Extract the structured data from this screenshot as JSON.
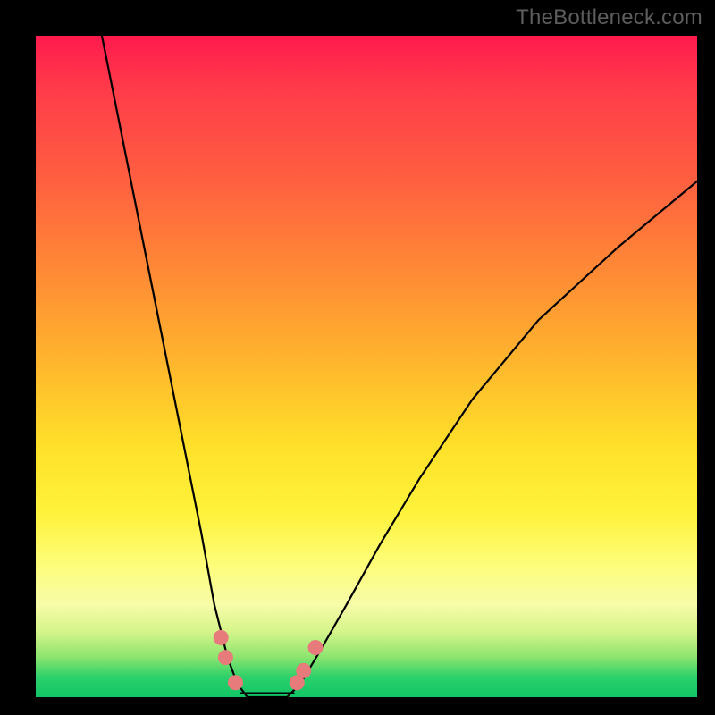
{
  "watermark": "TheBottleneck.com",
  "chart_data": {
    "type": "line",
    "title": "",
    "xlabel": "",
    "ylabel": "",
    "xlim": [
      0,
      100
    ],
    "ylim": [
      0,
      100
    ],
    "grid": false,
    "legend": false,
    "series": [
      {
        "name": "left-branch",
        "x": [
          10,
          13,
          16,
          19,
          22,
          25,
          27,
          29,
          30.5,
          32
        ],
        "y": [
          100,
          85,
          70,
          55,
          40,
          25,
          14,
          6,
          2,
          0
        ]
      },
      {
        "name": "right-branch",
        "x": [
          38,
          40,
          43,
          47,
          52,
          58,
          66,
          76,
          88,
          100
        ],
        "y": [
          0,
          2,
          7,
          14,
          23,
          33,
          45,
          57,
          68,
          78
        ]
      },
      {
        "name": "trough-flat",
        "x": [
          32,
          34,
          36,
          38
        ],
        "y": [
          0,
          0,
          0,
          0
        ]
      }
    ],
    "markers": [
      {
        "x": 28,
        "y": 9
      },
      {
        "x": 28.7,
        "y": 6
      },
      {
        "x": 30.2,
        "y": 2.2
      },
      {
        "x": 39.5,
        "y": 2.2
      },
      {
        "x": 40.5,
        "y": 4
      },
      {
        "x": 42.3,
        "y": 7.5
      }
    ],
    "trough_segment": {
      "x0": 31,
      "x1": 39,
      "y": 0.6
    },
    "colors": {
      "curve": "#000000",
      "marker": "#e77a7a",
      "background_top": "#ff1a4d",
      "background_bottom": "#11c566"
    }
  }
}
